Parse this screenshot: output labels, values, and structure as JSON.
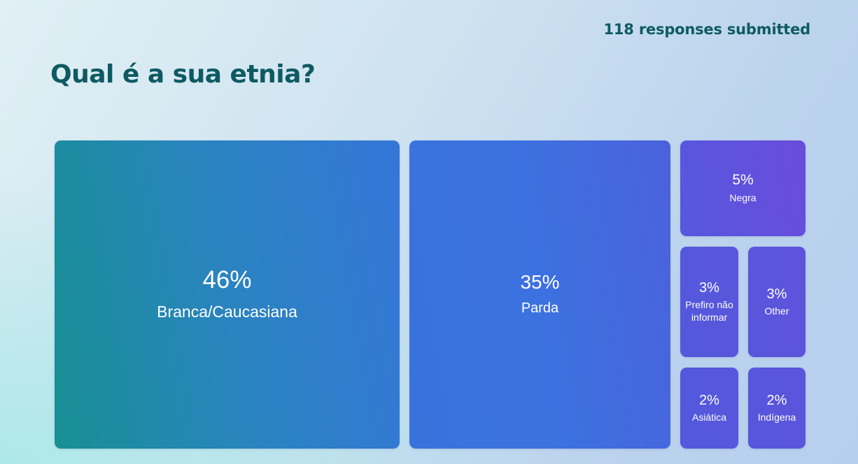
{
  "header": {
    "responses_text": "118 responses submitted"
  },
  "question": {
    "title": "Qual é a sua etnia?"
  },
  "colors": {
    "title": "#0e5a63",
    "teal": "#178f93",
    "blue": "#3b72e0",
    "purple": "#6a4cdc"
  },
  "chart_data": {
    "type": "treemap",
    "title": "Qual é a sua etnia?",
    "total_responses": 118,
    "items": [
      {
        "label": "Branca/Caucasiana",
        "value": 46,
        "pct_text": "46%"
      },
      {
        "label": "Parda",
        "value": 35,
        "pct_text": "35%"
      },
      {
        "label": "Negra",
        "value": 5,
        "pct_text": "5%"
      },
      {
        "label": "Prefiro não informar",
        "value": 3,
        "pct_text": "3%"
      },
      {
        "label": "Other",
        "value": 3,
        "pct_text": "3%"
      },
      {
        "label": "Asiática",
        "value": 2,
        "pct_text": "2%"
      },
      {
        "label": "Indígena",
        "value": 2,
        "pct_text": "2%"
      }
    ]
  }
}
